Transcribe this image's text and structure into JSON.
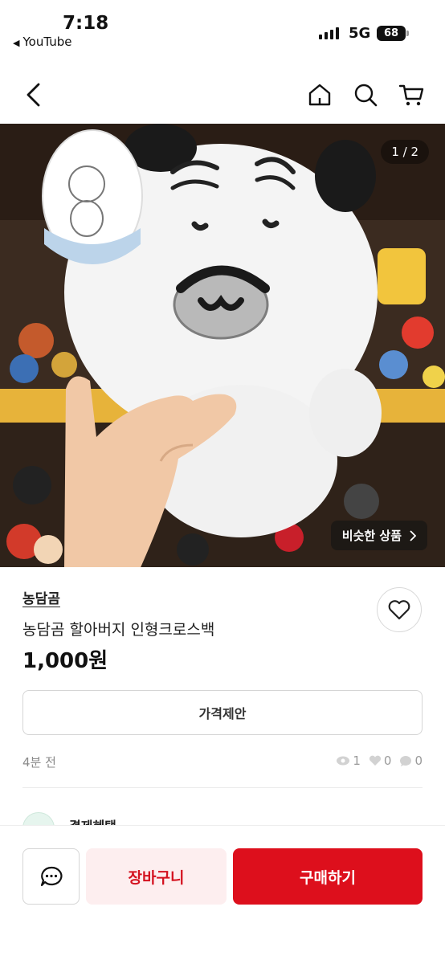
{
  "status_bar": {
    "time": "7:18",
    "back_app": "YouTube",
    "network": "5G",
    "battery": "68"
  },
  "nav": {
    "icons": [
      "back-arrow-icon",
      "home-icon",
      "search-icon",
      "cart-icon"
    ]
  },
  "gallery": {
    "counter": "1 / 2",
    "similar_label": "비슷한 상품",
    "image_subject": "white plush bear with gray nose held in hand"
  },
  "product": {
    "store": "농담곰",
    "title": "농담곰 할아버지 인형크로스백",
    "price": "1,000원",
    "offer_label": "가격제안",
    "time_ago": "4분 전",
    "views": "1",
    "likes": "0",
    "chats": "0"
  },
  "benefit": {
    "label": "결제혜택"
  },
  "bottom": {
    "cart_label": "장바구니",
    "buy_label": "구매하기"
  },
  "colors": {
    "accent": "#dd0f1c",
    "accent_light": "#fdeeef"
  }
}
